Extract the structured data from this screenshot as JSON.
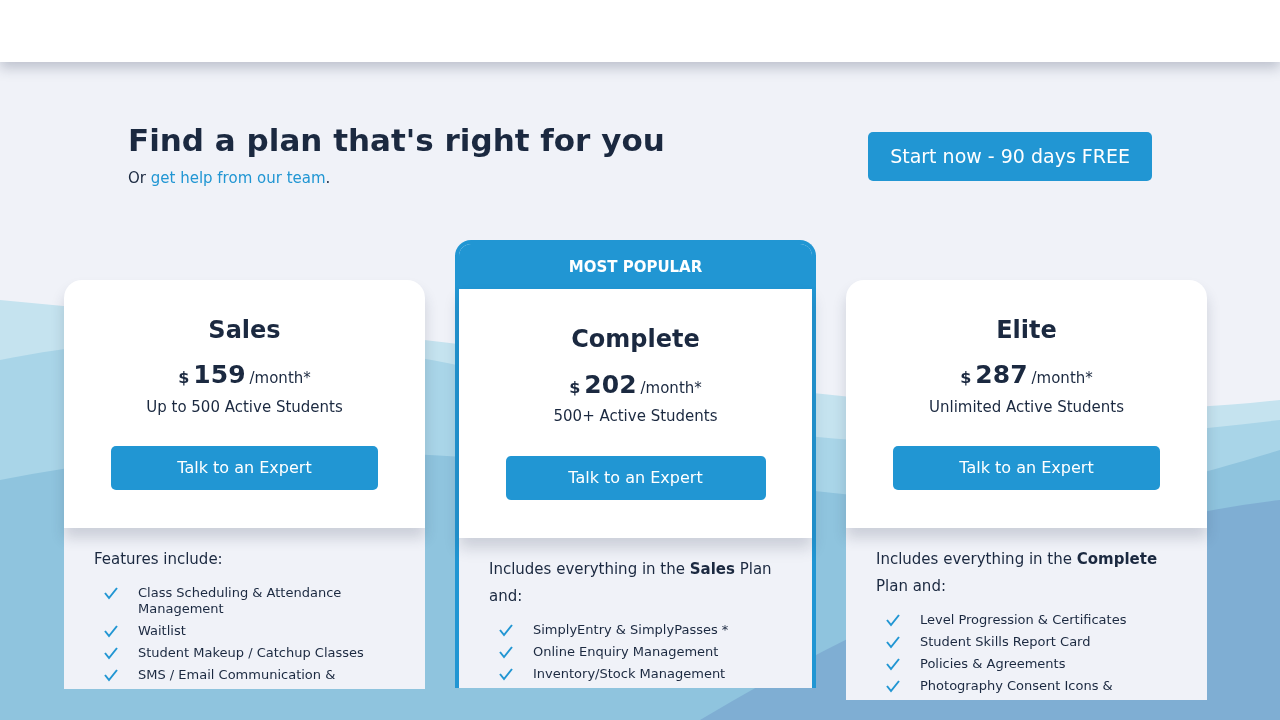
{
  "hero": {
    "title": "Find a plan that's right for you",
    "subtitle_prefix": "Or ",
    "subtitle_link": "get help from our team",
    "subtitle_suffix": ".",
    "cta": "Start now - 90 days FREE"
  },
  "plans": [
    {
      "name": "Sales",
      "featured": false,
      "currency": "$",
      "price": "159",
      "period": "/month*",
      "students": "Up to 500 Active Students",
      "button": "Talk to an Expert",
      "intro": "Features include:",
      "features": [
        "Class Scheduling & Attendance Management",
        "Waitlist",
        "Student Makeup / Catchup Classes",
        "SMS / Email Communication &"
      ]
    },
    {
      "name": "Complete",
      "featured": true,
      "badge": "MOST POPULAR",
      "currency": "$",
      "price": "202",
      "period": "/month*",
      "students": "500+ Active Students",
      "button": "Talk to an Expert",
      "intro": "Includes everything in the **Sales** Plan and:",
      "features": [
        "SimplyEntry & SimplyPasses *",
        "Online Enquiry Management",
        "Inventory/Stock Management"
      ]
    },
    {
      "name": "Elite",
      "featured": false,
      "currency": "$",
      "price": "287",
      "period": "/month*",
      "students": "Unlimited Active Students",
      "button": "Talk to an Expert",
      "intro": "Includes everything in the **Complete** Plan and:",
      "features": [
        "Level Progression & Certificates",
        "Student Skills Report Card",
        "Policies & Agreements",
        "Photography Consent Icons &"
      ]
    }
  ]
}
